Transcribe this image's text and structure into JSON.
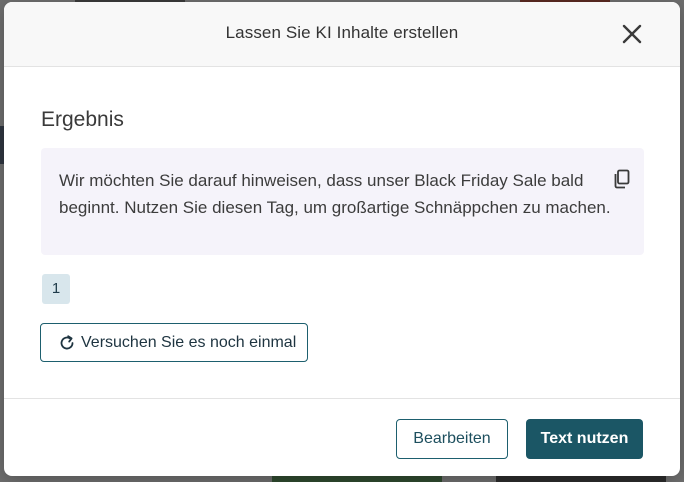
{
  "dialog": {
    "title": "Lassen Sie KI Inhalte erstellen",
    "close_icon": "close-icon"
  },
  "result": {
    "heading": "Ergebnis",
    "text": "Wir möchten Sie darauf hinweisen, dass unser Black Friday Sale bald beginnt. Nutzen Sie diesen Tag, um großartige Schnäppchen zu machen.",
    "copy_icon": "copy-icon",
    "page_number": "1"
  },
  "actions": {
    "retry_label": "Versuchen Sie es noch einmal",
    "retry_icon": "refresh-icon",
    "edit_label": "Bearbeiten",
    "use_label": "Text nutzen"
  },
  "colors": {
    "accent": "#1b5665",
    "result_background": "#f5f3fa",
    "badge_background": "#d8e6ec"
  }
}
